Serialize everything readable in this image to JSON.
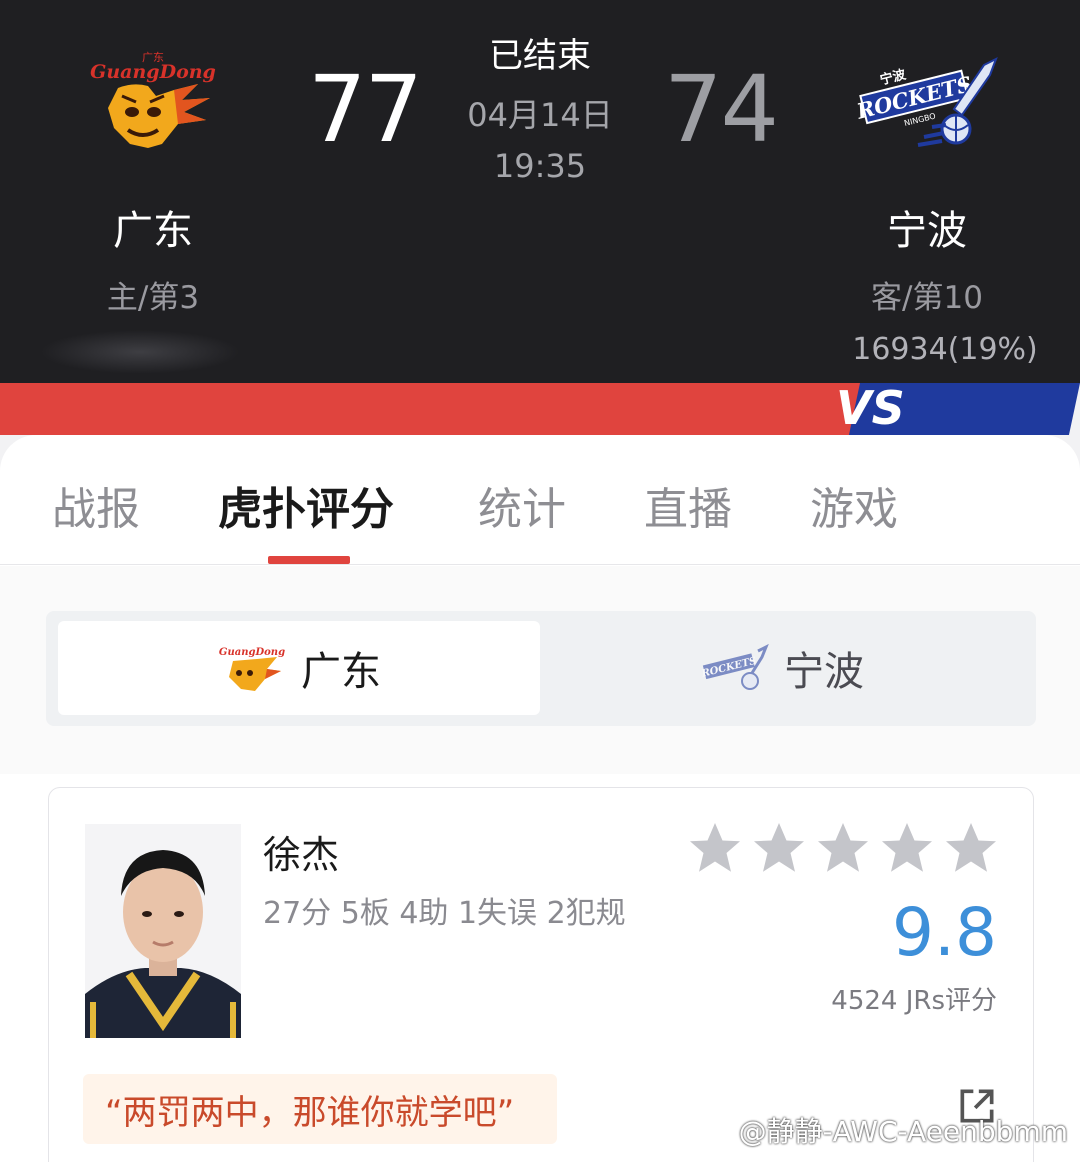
{
  "match": {
    "status": "已结束",
    "date": "04月14日",
    "time": "19:35",
    "home": {
      "name": "广东",
      "score": "77",
      "rank": "主/第3",
      "logo_text": "GuangDong",
      "logo_top": "广东",
      "accent": "#d8322a"
    },
    "away": {
      "name": "宁波",
      "score": "74",
      "rank": "客/第10",
      "support": "16934(19%)",
      "logo_text": "ROCKETS",
      "logo_top": "宁波",
      "logo_sub": "NINGBO",
      "accent": "#1f3a9e"
    },
    "vs_label": "VS"
  },
  "tabs": [
    {
      "label": "战报",
      "active": false
    },
    {
      "label": "虎扑评分",
      "active": true
    },
    {
      "label": "统计",
      "active": false
    },
    {
      "label": "直播",
      "active": false
    },
    {
      "label": "游戏",
      "active": false
    }
  ],
  "team_switch": {
    "home_label": "广东",
    "away_label": "宁波",
    "selected": "home"
  },
  "player": {
    "name": "徐杰",
    "stats": "27分 5板 4助 1失误 2犯规",
    "stars_filled": 0,
    "stars_total": 5,
    "rating": "9.8",
    "rating_count": "4524 JRs评分",
    "quote": "“两罚两中，那谁你就学吧”"
  },
  "watermark": "@静静-AWC-Aeenbbmm",
  "colors": {
    "header_bg": "#1f1f22",
    "tab_underline": "#e0443e",
    "rating": "#3d8fd9",
    "quote_text": "#c94a2b"
  }
}
